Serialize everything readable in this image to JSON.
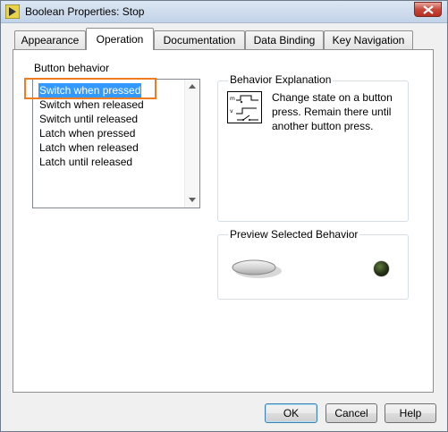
{
  "window": {
    "title": "Boolean Properties: Stop"
  },
  "tabs": [
    {
      "label": "Appearance",
      "active": false
    },
    {
      "label": "Operation",
      "active": true
    },
    {
      "label": "Documentation",
      "active": false
    },
    {
      "label": "Data Binding",
      "active": false
    },
    {
      "label": "Key Navigation",
      "active": false
    }
  ],
  "behavior_list": {
    "label": "Button behavior",
    "items": [
      "Switch when pressed",
      "Switch when released",
      "Switch until released",
      "Latch when pressed",
      "Latch when released",
      "Latch until released"
    ],
    "selected": "Switch when pressed"
  },
  "explanation": {
    "title": "Behavior Explanation",
    "text": "Change state on a button press.  Remain there until another button press.",
    "icon": "switch-timing-diagram-icon"
  },
  "preview": {
    "title": "Preview Selected Behavior",
    "led_color": "#2f3f1c"
  },
  "buttons": {
    "ok": "OK",
    "cancel": "Cancel",
    "help": "Help"
  },
  "colors": {
    "selection": "#3399ff",
    "highlight_outline": "#f07c21",
    "close_button": "#c8473a"
  }
}
